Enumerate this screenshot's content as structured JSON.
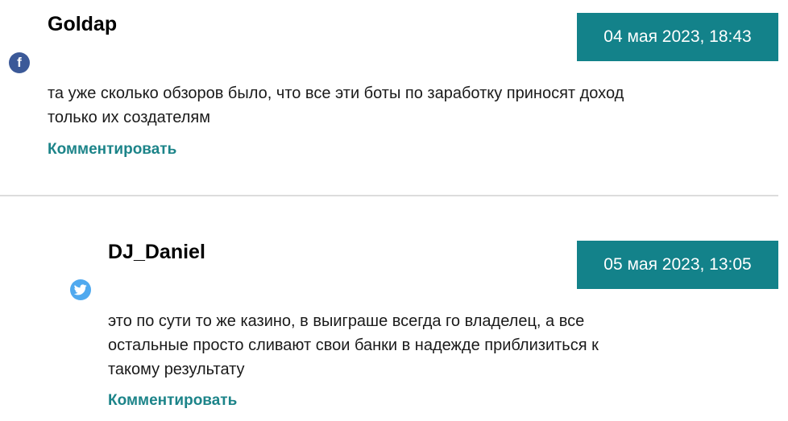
{
  "comments": [
    {
      "author": "Goldap",
      "date": "04 мая 2023, 18:43",
      "social": "facebook-icon",
      "text_lines": [
        "та уже сколько обзоров было, что все эти боты по заработку приносят доход",
        "только их создателям"
      ],
      "reply_label": "Комментировать"
    },
    {
      "author": "DJ_Daniel",
      "date": "05 мая 2023, 13:05",
      "social": "twitter-icon",
      "text_lines": [
        "это по сути то же казино, в выиграше всегда го владелец, а все",
        "остальные просто сливают свои банки в надежде приблизиться к",
        "такому результату"
      ],
      "reply_label": "Комментировать"
    }
  ],
  "colors": {
    "accent": "#13828a",
    "link": "#1c8489",
    "facebook": "#3b5998",
    "twitter": "#4fa9ef",
    "divider": "#dcdcdc"
  }
}
